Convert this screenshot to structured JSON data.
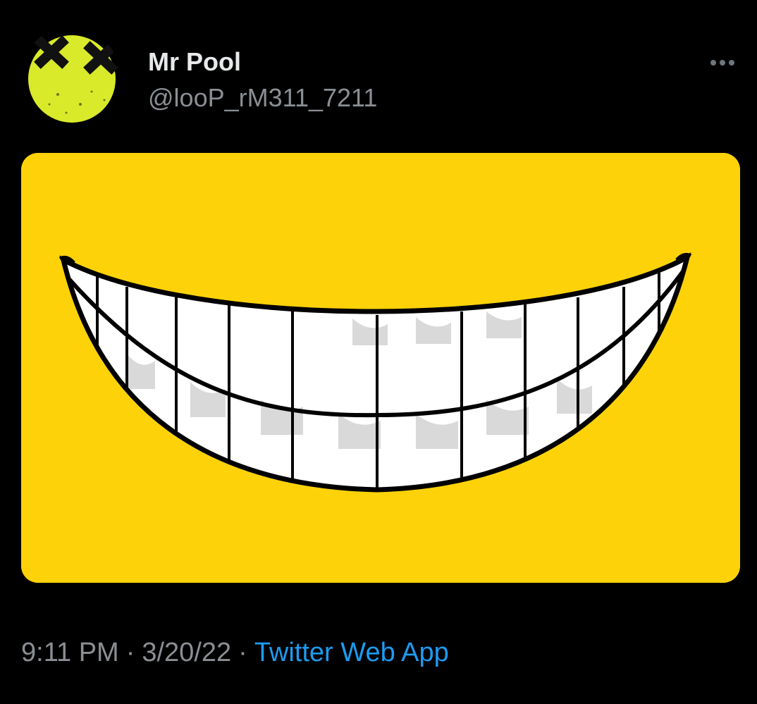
{
  "tweet": {
    "author": {
      "display_name": "Mr Pool",
      "handle": "@looP_rM311_7211",
      "avatar_icon": "smiley-avatar-icon",
      "avatar_color": "#d8ea2a"
    },
    "more_icon": "more-options-icon",
    "media": {
      "background_color": "#fdd209",
      "image_subject": "grin-icon"
    },
    "meta": {
      "time": "9:11 PM",
      "separator": "·",
      "date": "3/20/22",
      "source": "Twitter Web App"
    },
    "colors": {
      "background": "#000000",
      "primary_text": "#e7e9ea",
      "secondary_text": "#8b8f94",
      "link": "#1d9bf0"
    }
  }
}
